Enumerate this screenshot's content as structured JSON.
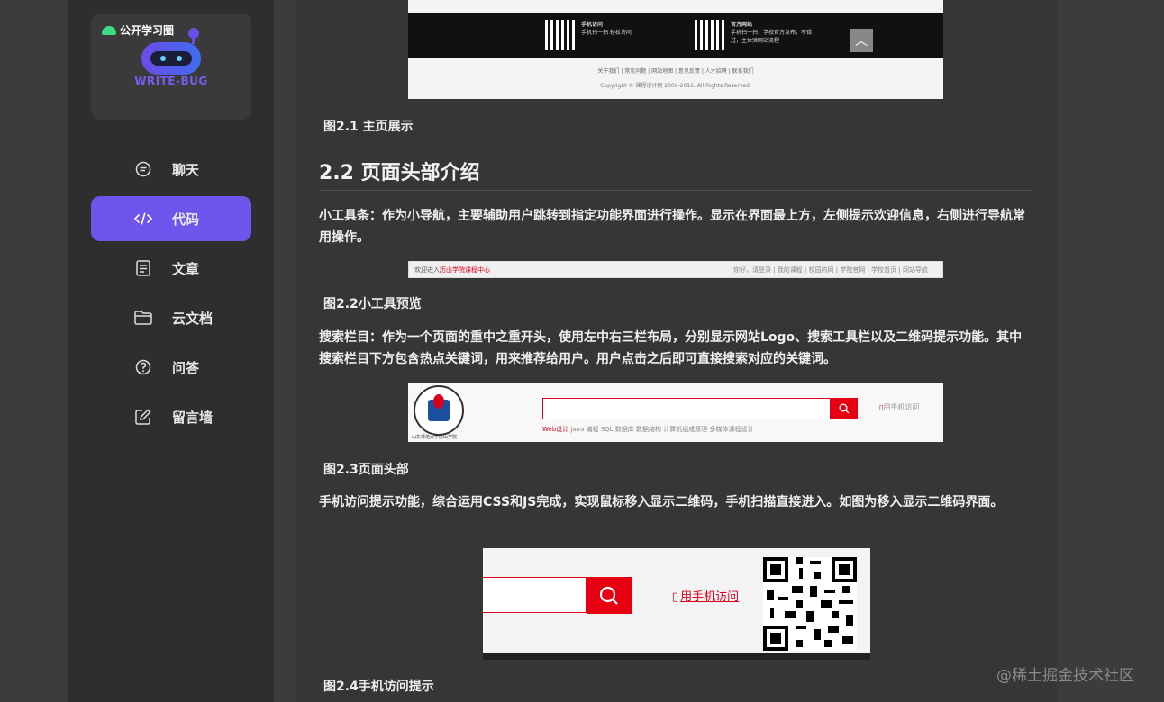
{
  "sidebar": {
    "logo_badge": "公开学习圈",
    "logo_text": "WRITE-BUG",
    "items": [
      {
        "label": "聊天",
        "icon": "chat-icon"
      },
      {
        "label": "代码",
        "icon": "code-icon",
        "active": true
      },
      {
        "label": "文章",
        "icon": "article-icon"
      },
      {
        "label": "云文档",
        "icon": "folder-icon"
      },
      {
        "label": "问答",
        "icon": "question-icon"
      },
      {
        "label": "留言墙",
        "icon": "edit-icon"
      }
    ]
  },
  "content": {
    "fig_top": {
      "qr1_title": "手机访问",
      "qr1_desc": "手机扫一扫 轻松访问",
      "qr2_title": "官方网站",
      "qr2_desc": "手机扫一扫，学校官方发布，不错过，主体验网站流程",
      "footer_links": "关于我们  |  常见问题  |  网站地图  |  意见反馈  |  人才招聘  |  联系我们",
      "copyright": "Copyright © 课程设计网 2006-2016. All Rights Reserved."
    },
    "caption1": "图2.1 主页展示",
    "heading": "2.2 页面头部介绍",
    "para1": "小工具条：作为小导航，主要辅助用户跳转到指定功能界面进行操作。显示在界面最上方，左侧提示欢迎信息，右侧进行导航常用操作。",
    "toolbar_fig": {
      "welcome_prefix": "欢迎进入",
      "welcome_site": "历山学院课程中心",
      "links": "你好，请登录  |  我的课程  |  校园内网  |  学院官网  |  学校首页  |  网站导航"
    },
    "caption2": "图2.2小工具预览",
    "para2": "搜索栏目：作为一个页面的重中之重开头，使用左中右三栏布局，分别显示网站Logo、搜索工具栏以及二维码提示功能。其中搜索栏目下方包含热点关键词，用来推荐给用户。用户点击之后即可直接搜索对应的关键词。",
    "header_fig": {
      "school": "山东师范大学历山学院",
      "mobile": "用手机访问",
      "hot_first": "Web设计",
      "hot_rest": "  Java 编程  SQL 数据库  数据结构  计算机组成原理  多媒体课程设计"
    },
    "caption3": "图2.3页面头部",
    "para3": "手机访问提示功能，综合运用CSS和JS完成，实现鼠标移入显示二维码，手机扫描直接进入。如图为移入显示二维码界面。",
    "mobile_fig": {
      "link": "用手机访问"
    },
    "caption4": "图2.4手机访问提示"
  },
  "watermark": "@稀土掘金技术社区",
  "colors": {
    "accent": "#6f55ec",
    "brand_red": "#e60012"
  }
}
